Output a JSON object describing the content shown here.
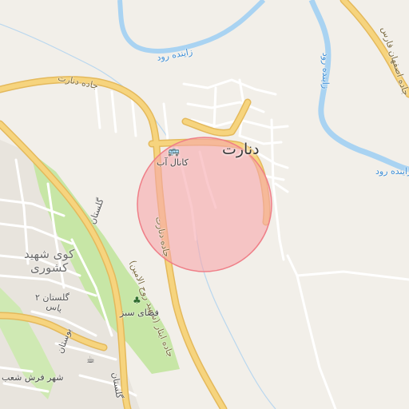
{
  "map": {
    "labels": {
      "town_danart": "دنارت",
      "district_kuy": "کوی شهید\nکشوری",
      "road_jade_danart": "جاده دنارت",
      "road_jade_danart_2": "جاده دنارت",
      "road_ishar": "جاده ایثار (شهید روح الامین)",
      "road_ostan_fars": "جاده اصفهان فارس",
      "river_1": "زاینده رود",
      "river_2": "زاینده رود",
      "river_3": "زاینده رود",
      "canal_ab": "کانال آب",
      "faza_sabz": "فضای سبز",
      "golestan_2": "گلستان ۲",
      "golestan": "گلستان",
      "golestan_3": "گلستان",
      "yas": "یاس",
      "bustan": "بوستان",
      "shahr_farsh": "شهر فرش شعب"
    },
    "icons": {
      "bus": "bus-stop-icon",
      "tree": "park-icon",
      "cafe": "cafe-icon"
    },
    "colors": {
      "background": "#f2efe9",
      "major_road": "#f6d47e",
      "road_casing": "#e4b95c",
      "minor_road": "#ffffff",
      "river": "#a9d3f2",
      "park": "#c7e6a6",
      "highlight_fill": "#f7a6ab",
      "highlight_stroke": "#ef7f88"
    }
  }
}
